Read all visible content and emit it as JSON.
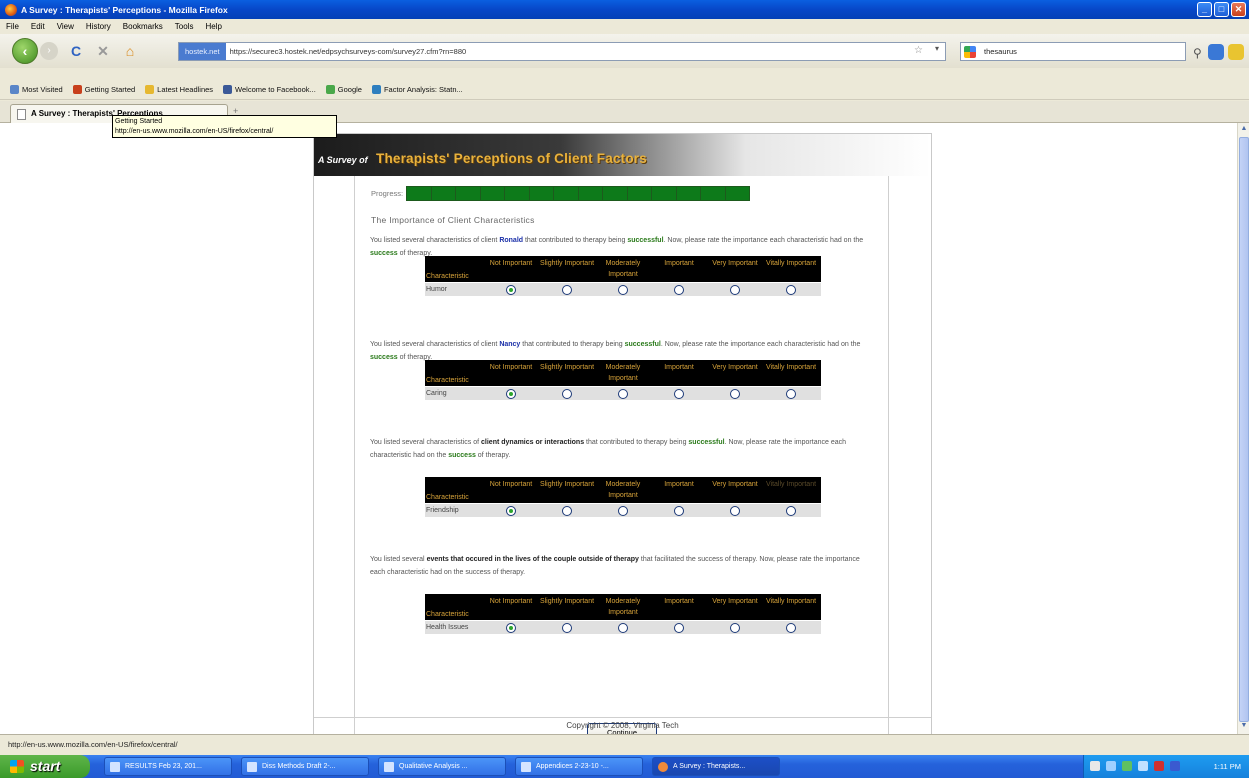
{
  "window": {
    "title": "A Survey : Therapists' Perceptions - Mozilla Firefox",
    "controls": [
      "minimize",
      "maximize",
      "close"
    ]
  },
  "menu": [
    "File",
    "Edit",
    "View",
    "History",
    "Bookmarks",
    "Tools",
    "Help"
  ],
  "nav": {
    "site_badge": "hostek.net",
    "url": "https://securec3.hostek.net/edpsychsurveys-com/survey27.cfm?rn=880",
    "search_value": "thesaurus"
  },
  "bookmarks": [
    "Most Visited",
    "Getting Started",
    "Latest Headlines",
    "Welcome to Facebook...",
    "Google",
    "Factor Analysis: Statn..."
  ],
  "tab": {
    "label": "A Survey : Therapists' Perceptions",
    "tooltip_title": "Getting Started",
    "tooltip_url": "http://en-us.www.mozilla.com/en-US/firefox/central/"
  },
  "survey": {
    "banner_prefix": "A Survey of",
    "banner_title": "Therapists' Perceptions of Client Factors",
    "progress_label": "Progress:",
    "progress_fraction": 1.0,
    "section_title": "The Importance of Client Characteristics",
    "columns": [
      "Characteristic",
      "Not Important",
      "Slightly Important",
      "Moderately Important",
      "Important",
      "Very Important",
      "Vitally Important"
    ],
    "questions": [
      {
        "parts": [
          {
            "t": "You listed several characteristics of client ",
            "s": ""
          },
          {
            "t": "Ronald",
            "s": "b"
          },
          {
            "t": " that contributed to therapy being ",
            "s": ""
          },
          {
            "t": "successful",
            "s": "g"
          },
          {
            "t": ". Now, please rate the importance each characteristic had on the ",
            "s": ""
          },
          {
            "t": "success",
            "s": "g"
          },
          {
            "t": " of therapy.",
            "s": ""
          }
        ],
        "item": "Humor",
        "selected": 0
      },
      {
        "parts": [
          {
            "t": "You listed several characteristics of client ",
            "s": ""
          },
          {
            "t": "Nancy",
            "s": "b"
          },
          {
            "t": " that contributed to therapy being ",
            "s": ""
          },
          {
            "t": "successful",
            "s": "g"
          },
          {
            "t": ". Now, please rate the importance each characteristic had on the ",
            "s": ""
          },
          {
            "t": "success",
            "s": "g"
          },
          {
            "t": " of therapy.",
            "s": ""
          }
        ],
        "item": "Caring",
        "selected": 0
      },
      {
        "parts": [
          {
            "t": "You listed several characteristics of ",
            "s": ""
          },
          {
            "t": "client dynamics or interactions",
            "s": "k"
          },
          {
            "t": " that contributed to therapy being ",
            "s": ""
          },
          {
            "t": "successful",
            "s": "g"
          },
          {
            "t": ". Now, please rate the importance each characteristic had on the ",
            "s": ""
          },
          {
            "t": "success",
            "s": "g"
          },
          {
            "t": " of therapy.",
            "s": ""
          }
        ],
        "item": "Friendship",
        "selected": 0
      },
      {
        "parts": [
          {
            "t": "You listed several ",
            "s": ""
          },
          {
            "t": "events that occured in the lives of the couple outside of therapy",
            "s": "k"
          },
          {
            "t": " that facilitated the success of therapy. Now, please rate the importance each characteristic had on the success of therapy.",
            "s": ""
          }
        ],
        "item": "Health Issues",
        "selected": 0
      }
    ],
    "continue_label": "Continue",
    "copyright": "Copyright © 2008, Virginia Tech"
  },
  "status_text": "http://en-us.www.mozilla.com/en-US/firefox/central/",
  "taskbar": {
    "start_label": "start",
    "tasks": [
      "RESULTS Feb 23, 201...",
      "Diss Methods Draft 2-...",
      "Qualitative Analysis ...",
      "Appendices 2-23-10 -...",
      "A Survey : Therapists..."
    ],
    "clock": "1:11 PM"
  }
}
